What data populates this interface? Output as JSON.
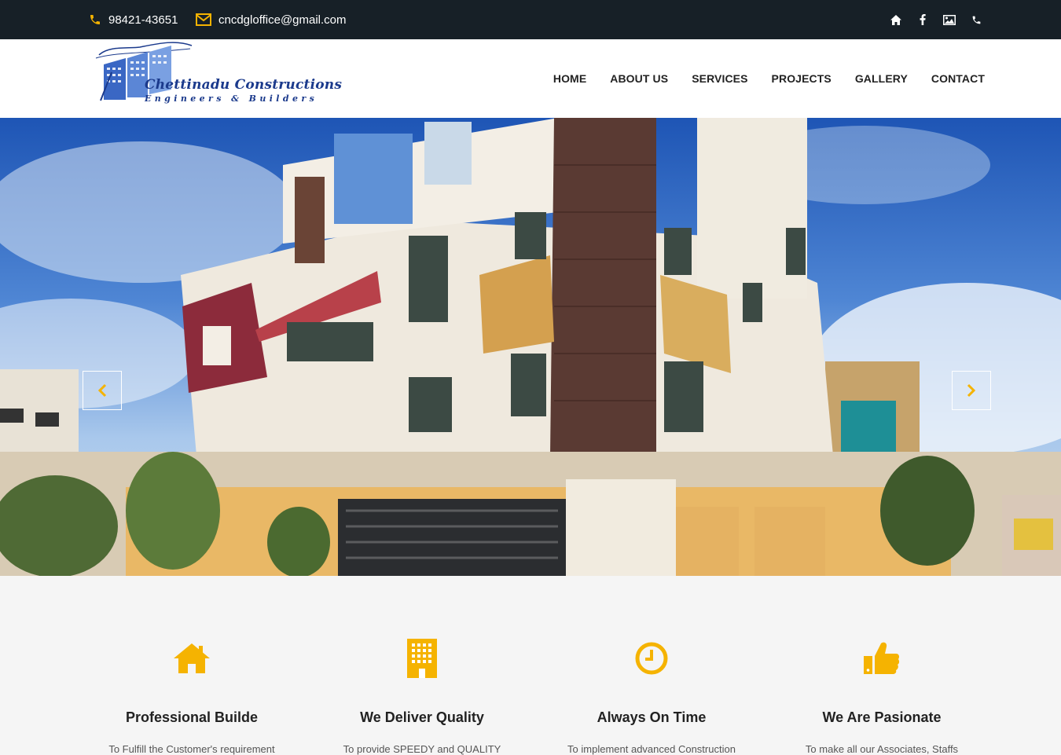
{
  "topbar": {
    "phone": "98421-43651",
    "email": "cncdgloffice@gmail.com",
    "social_icons": [
      "home-icon",
      "facebook-icon",
      "gallery-icon",
      "phone-icon"
    ]
  },
  "logo": {
    "brand": "Chettinadu Constructions",
    "tagline": "Engineers & Builders"
  },
  "nav": [
    "HOME",
    "ABOUT US",
    "SERVICES",
    "PROJECTS",
    "GALLERY",
    "CONTACT"
  ],
  "features": [
    {
      "icon": "home-icon",
      "title": "Professional Builde",
      "text": "To Fulfill the Customer's requirement"
    },
    {
      "icon": "building-icon",
      "title": "We Deliver Quality",
      "text": "To provide SPEEDY and QUALITY"
    },
    {
      "icon": "clock-icon",
      "title": "Always On Time",
      "text": "To implement advanced Construction"
    },
    {
      "icon": "thumbs-up-icon",
      "title": "We Are Pasionate",
      "text": "To make all our Associates, Staffs"
    }
  ],
  "colors": {
    "accent": "#f5b301",
    "topbar": "#172027",
    "text": "#222222"
  }
}
